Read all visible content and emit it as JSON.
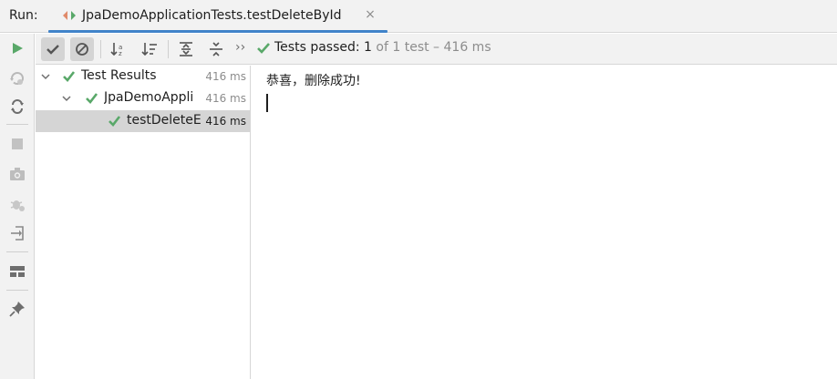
{
  "header": {
    "run_label": "Run:",
    "tab_title": "JpaDemoApplicationTests.testDeleteById",
    "close_glyph": "×"
  },
  "left_toolbar": {
    "buttons": [
      "rerun-icon",
      "rerun-failed-icon",
      "toggle-auto-test-icon",
      "stop-icon",
      "snapshot-icon",
      "debug-settings-icon",
      "exit-icon",
      "layout-icon",
      "pin-icon"
    ]
  },
  "toolbar": {
    "buttons": [
      "show-passed-icon",
      "show-ignored-icon",
      "sort-alpha-icon",
      "sort-duration-icon",
      "expand-all-icon",
      "collapse-all-icon"
    ],
    "more_glyph": "››",
    "status_passed": "Tests passed: ",
    "status_count": "1",
    "status_rest": " of 1 test – 416 ms"
  },
  "tree": {
    "rows": [
      {
        "label": "Test Results",
        "time": "416 ms"
      },
      {
        "label": "JpaDemoAppli",
        "time": "416 ms"
      },
      {
        "label": "testDeleteE",
        "time": "416 ms"
      }
    ]
  },
  "console": {
    "output_line": "恭喜，删除成功!"
  },
  "colors": {
    "accent": "#4083c9",
    "pass_green": "#59a869",
    "run_green": "#59a869",
    "toolbar_bg": "#f2f2f2",
    "selected_bg": "#d5d5d5"
  }
}
